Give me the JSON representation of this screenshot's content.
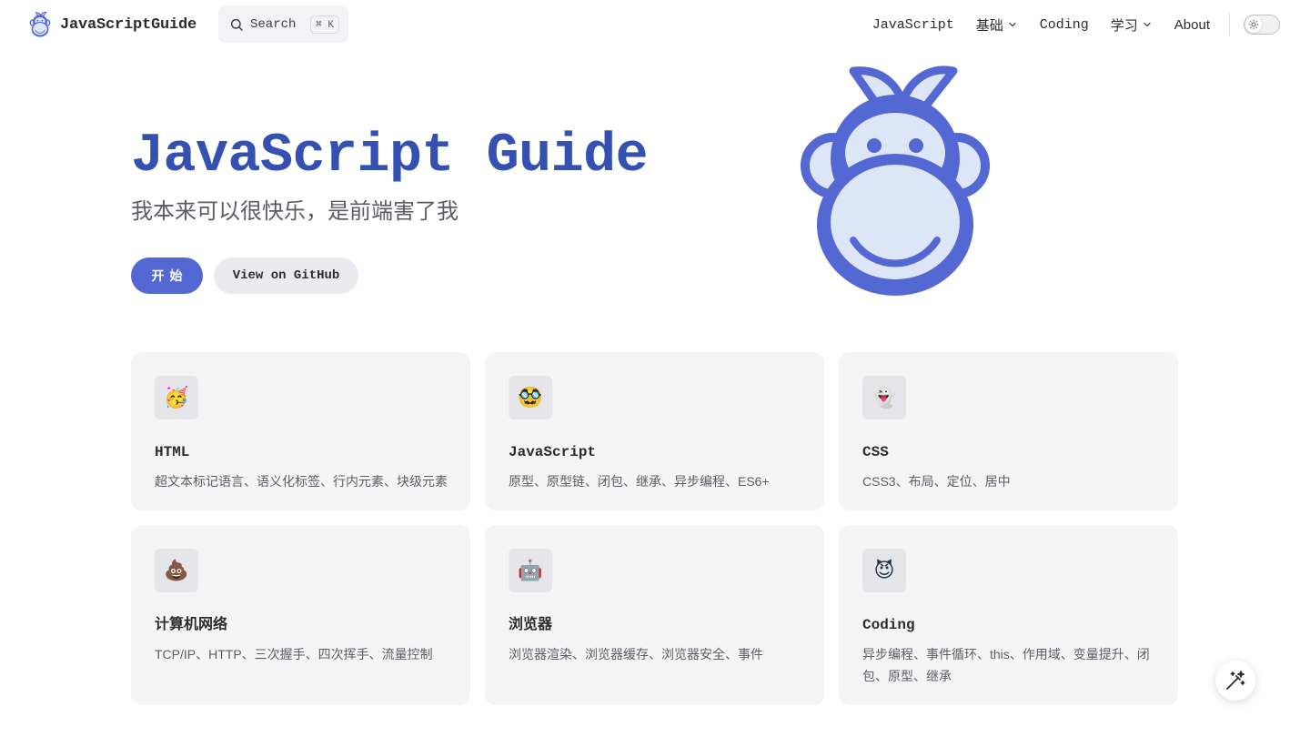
{
  "brand": {
    "title": "JavaScriptGuide",
    "logo_icon": "monkey-logo-icon"
  },
  "search": {
    "label": "Search",
    "shortcut": "⌘ K",
    "icon": "search-icon"
  },
  "nav": {
    "items": [
      {
        "label": "JavaScript",
        "dropdown": false
      },
      {
        "label": "基础",
        "dropdown": true
      },
      {
        "label": "Coding",
        "dropdown": false
      },
      {
        "label": "学习",
        "dropdown": true
      },
      {
        "label": "About",
        "dropdown": false
      }
    ],
    "theme_toggle_icon": "sun-icon"
  },
  "hero": {
    "title": "JavaScript Guide",
    "tagline": "我本来可以很快乐，是前端害了我",
    "actions": [
      {
        "label": "开始",
        "style": "brand"
      },
      {
        "label": "View on GitHub",
        "style": "alt"
      }
    ],
    "image_icon": "monkey-mascot-icon"
  },
  "features": [
    {
      "icon": "🥳",
      "title": "HTML",
      "details": "超文本标记语言、语义化标签、行内元素、块级元素"
    },
    {
      "icon": "🥸",
      "title": "JavaScript",
      "details": "原型、原型链、闭包、继承、异步编程、ES6+"
    },
    {
      "icon": "👻",
      "title": "CSS",
      "details": "CSS3、布局、定位、居中"
    },
    {
      "icon": "💩",
      "title": "计算机网络",
      "details": "TCP/IP、HTTP、三次握手、四次挥手、流量控制"
    },
    {
      "icon": "🤖",
      "title": "浏览器",
      "details": "浏览器渲染、浏览器缓存、浏览器安全、事件"
    },
    {
      "icon": "😈",
      "title": "Coding",
      "details": "异步编程、事件循环、this、作用域、变量提升、闭包、原型、继承"
    }
  ],
  "colors": {
    "brand": "#5468d4",
    "title": "#3451b2",
    "card_bg": "#f5f5f6"
  },
  "fab_icon": "magic-wand-icon"
}
